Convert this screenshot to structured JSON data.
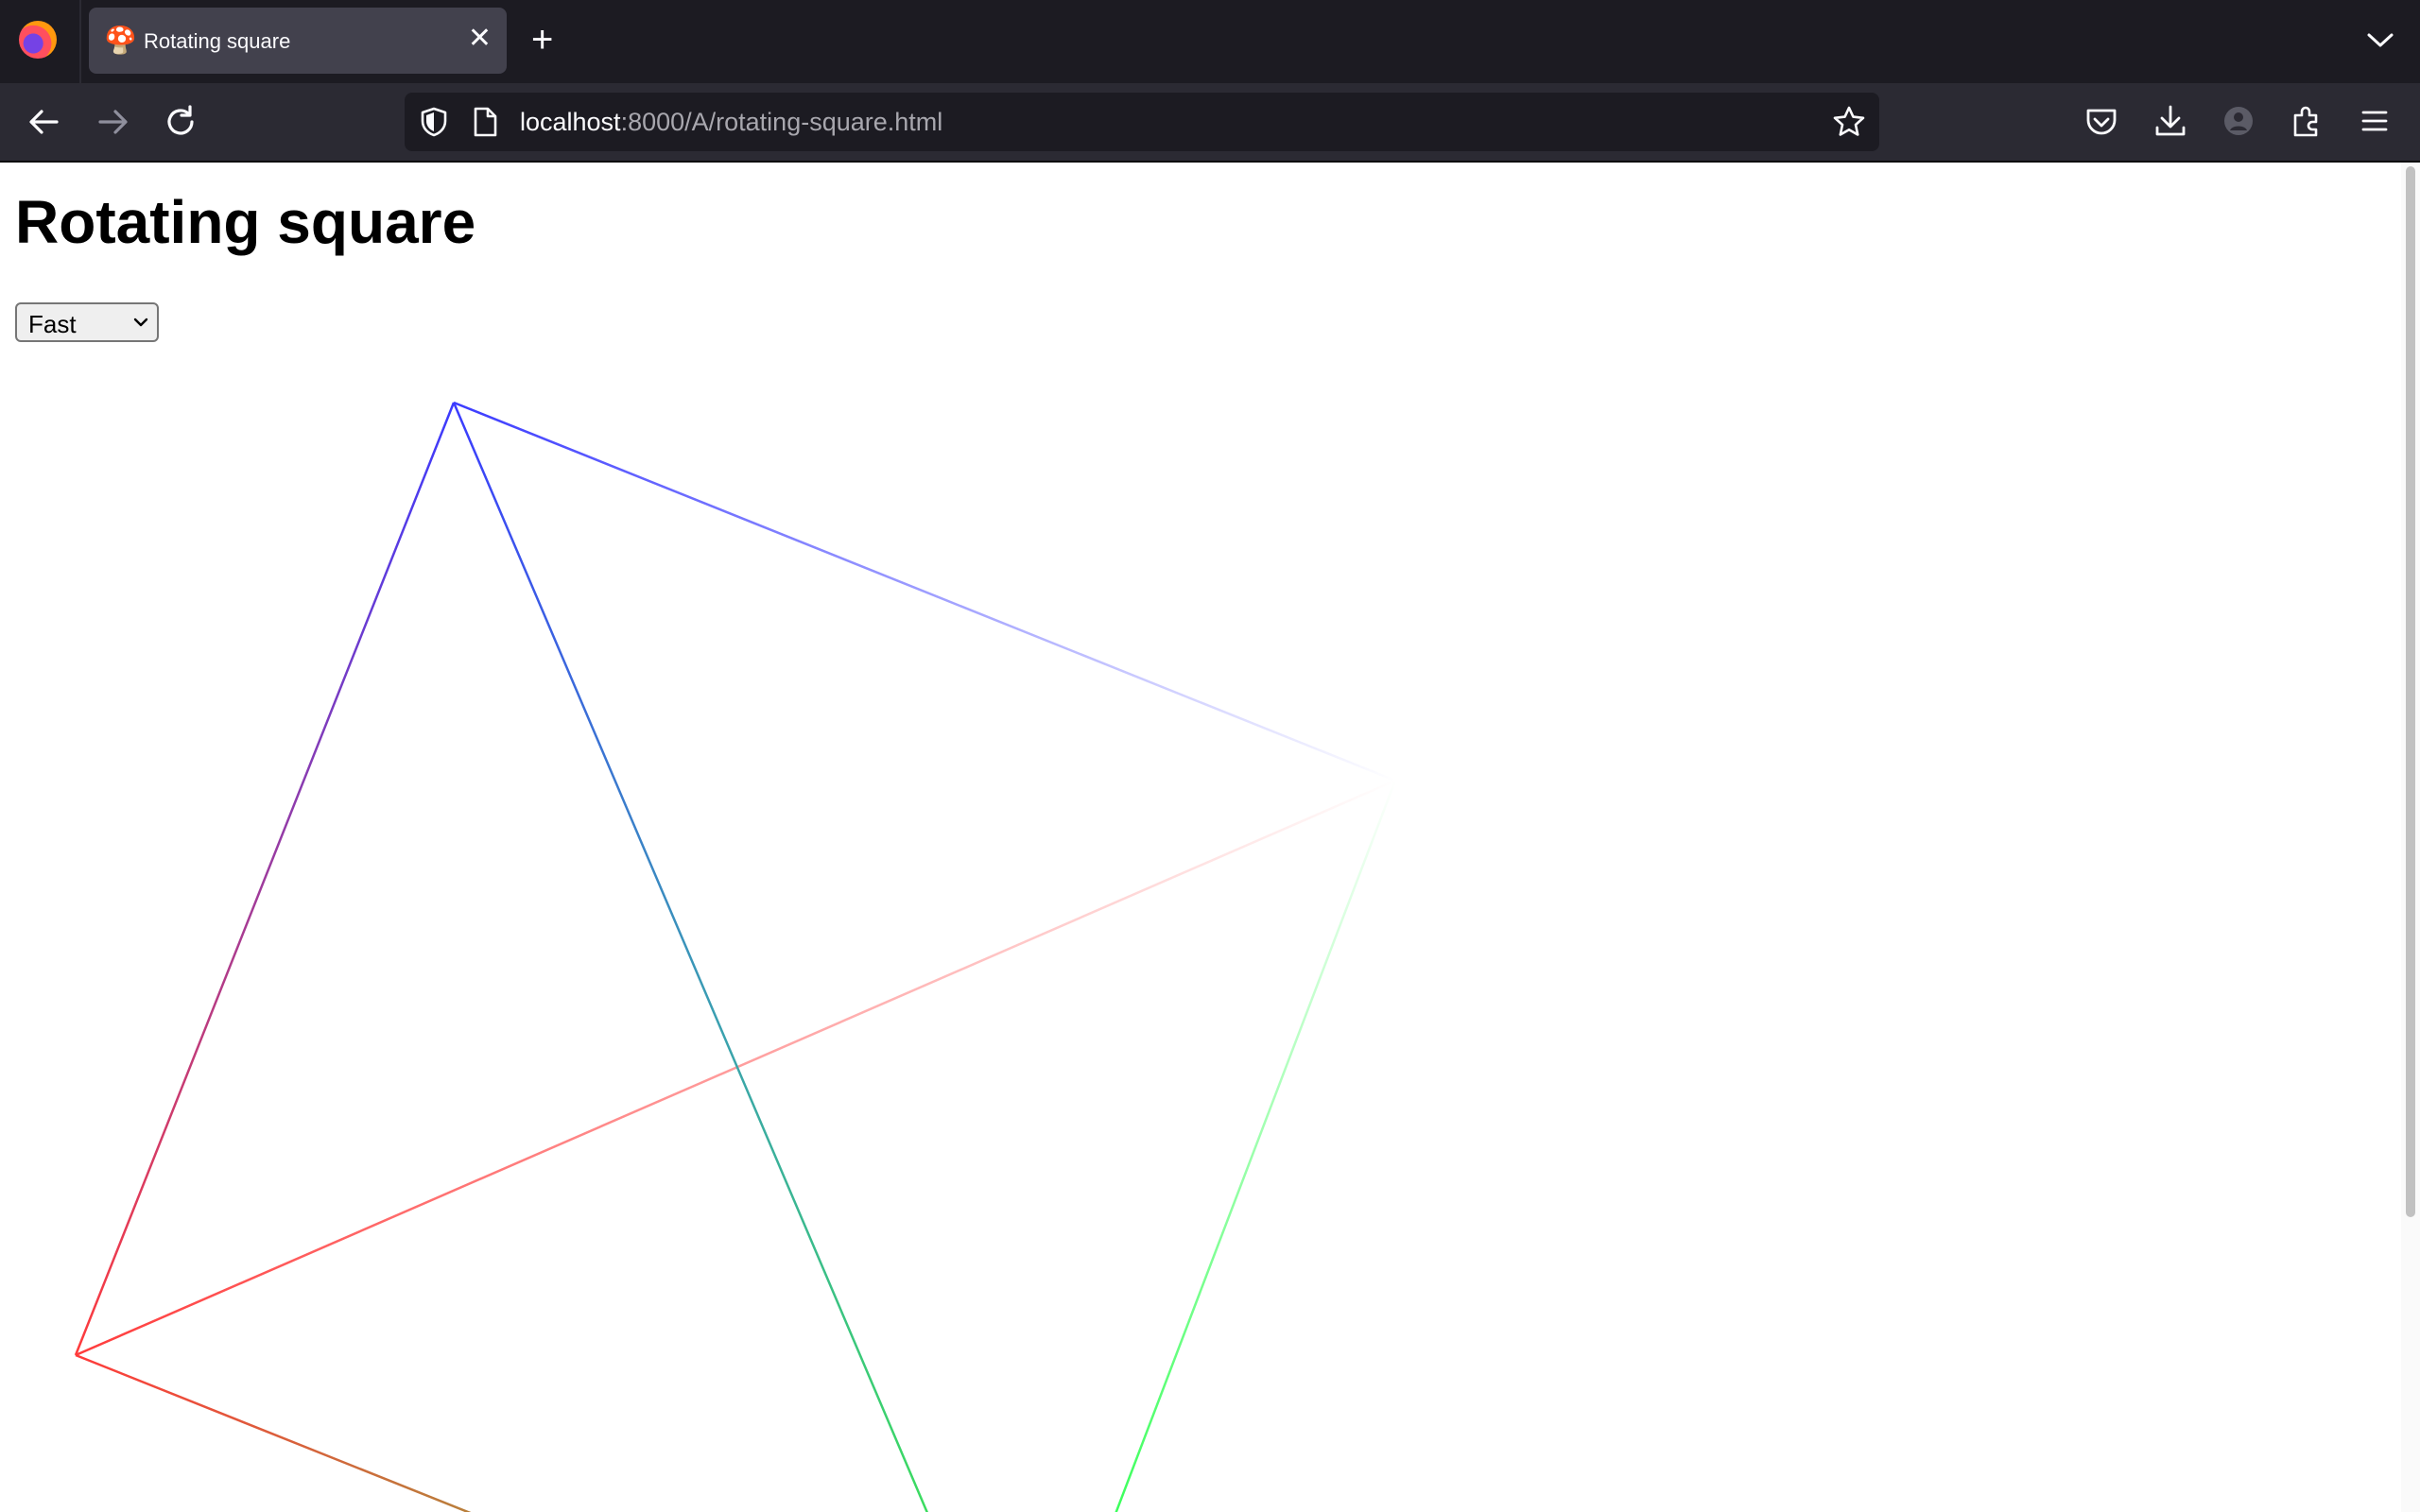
{
  "browser": {
    "tab": {
      "title": "Rotating square"
    },
    "url": {
      "host": "localhost",
      "path": ":8000/A/rotating-square.html"
    }
  },
  "page": {
    "title": "Rotating square",
    "speed_select": {
      "selected": "Fast"
    }
  },
  "canvas": {
    "description_shape": "rotating-square-wireframe",
    "colors": {
      "blue": "#3b3bff",
      "red": "#ff3b3b",
      "green": "#3bdf5b",
      "teal": "#3aa0b0"
    }
  },
  "colors": {
    "tabbar_bg": "#1c1b22",
    "navbar_bg": "#2b2a33",
    "active_tab_bg": "#42414d",
    "chrome_text": "#fbfbfe"
  }
}
